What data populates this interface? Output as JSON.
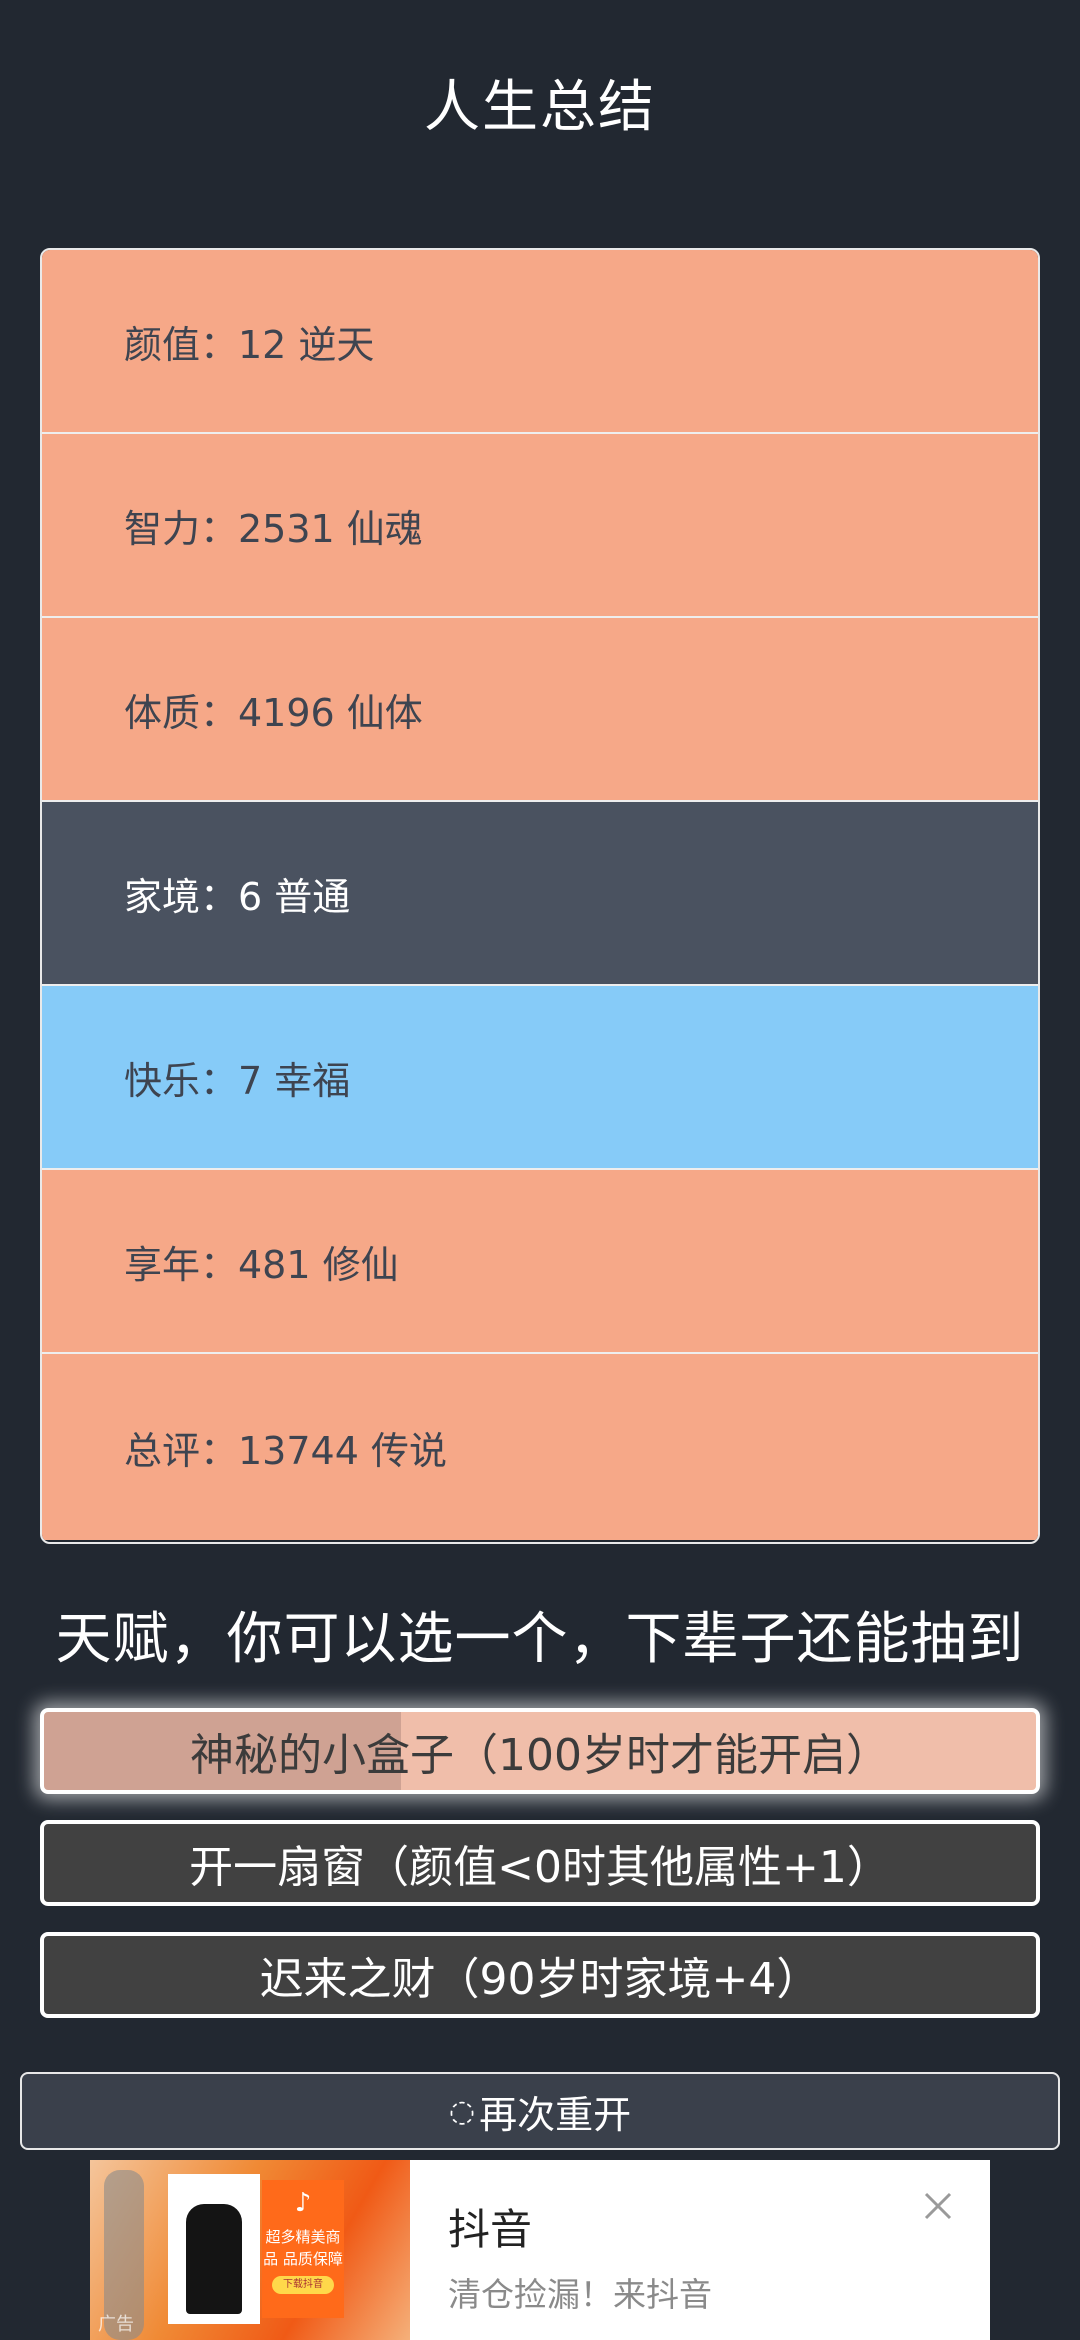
{
  "header": {
    "title": "人生总结"
  },
  "stats": [
    {
      "label": "颜值：12 逆天",
      "color": "#f6a888"
    },
    {
      "label": "智力：2531 仙魂",
      "color": "#f6a888"
    },
    {
      "label": "体质：4196 仙体",
      "color": "#f6a888"
    },
    {
      "label": "家境：6 普通",
      "color": "#4a5260"
    },
    {
      "label": "快乐：7 幸福",
      "color": "#86cbf8"
    },
    {
      "label": "享年：481 修仙",
      "color": "#f6a888"
    },
    {
      "label": "总评：13744 传说",
      "color": "#f6a888"
    }
  ],
  "talents": {
    "heading": "天赋，你可以选一个，下辈子还能抽到",
    "items": [
      {
        "label": "神秘的小盒子（100岁时才能开启）",
        "selected": true
      },
      {
        "label": "开一扇窗（颜值<0时其他属性+1）",
        "selected": false
      },
      {
        "label": "迟来之财（90岁时家境+4）",
        "selected": false
      }
    ]
  },
  "restart": {
    "icon": "refresh-icon",
    "label": "再次重开"
  },
  "ad": {
    "name": "抖音",
    "desc": "清仓捡漏！来抖音",
    "tag": "广告",
    "promo_brand": "♪",
    "promo_text": "超多精美商品 品质保障",
    "promo_button": "下载抖音",
    "close_icon": "close-icon"
  }
}
